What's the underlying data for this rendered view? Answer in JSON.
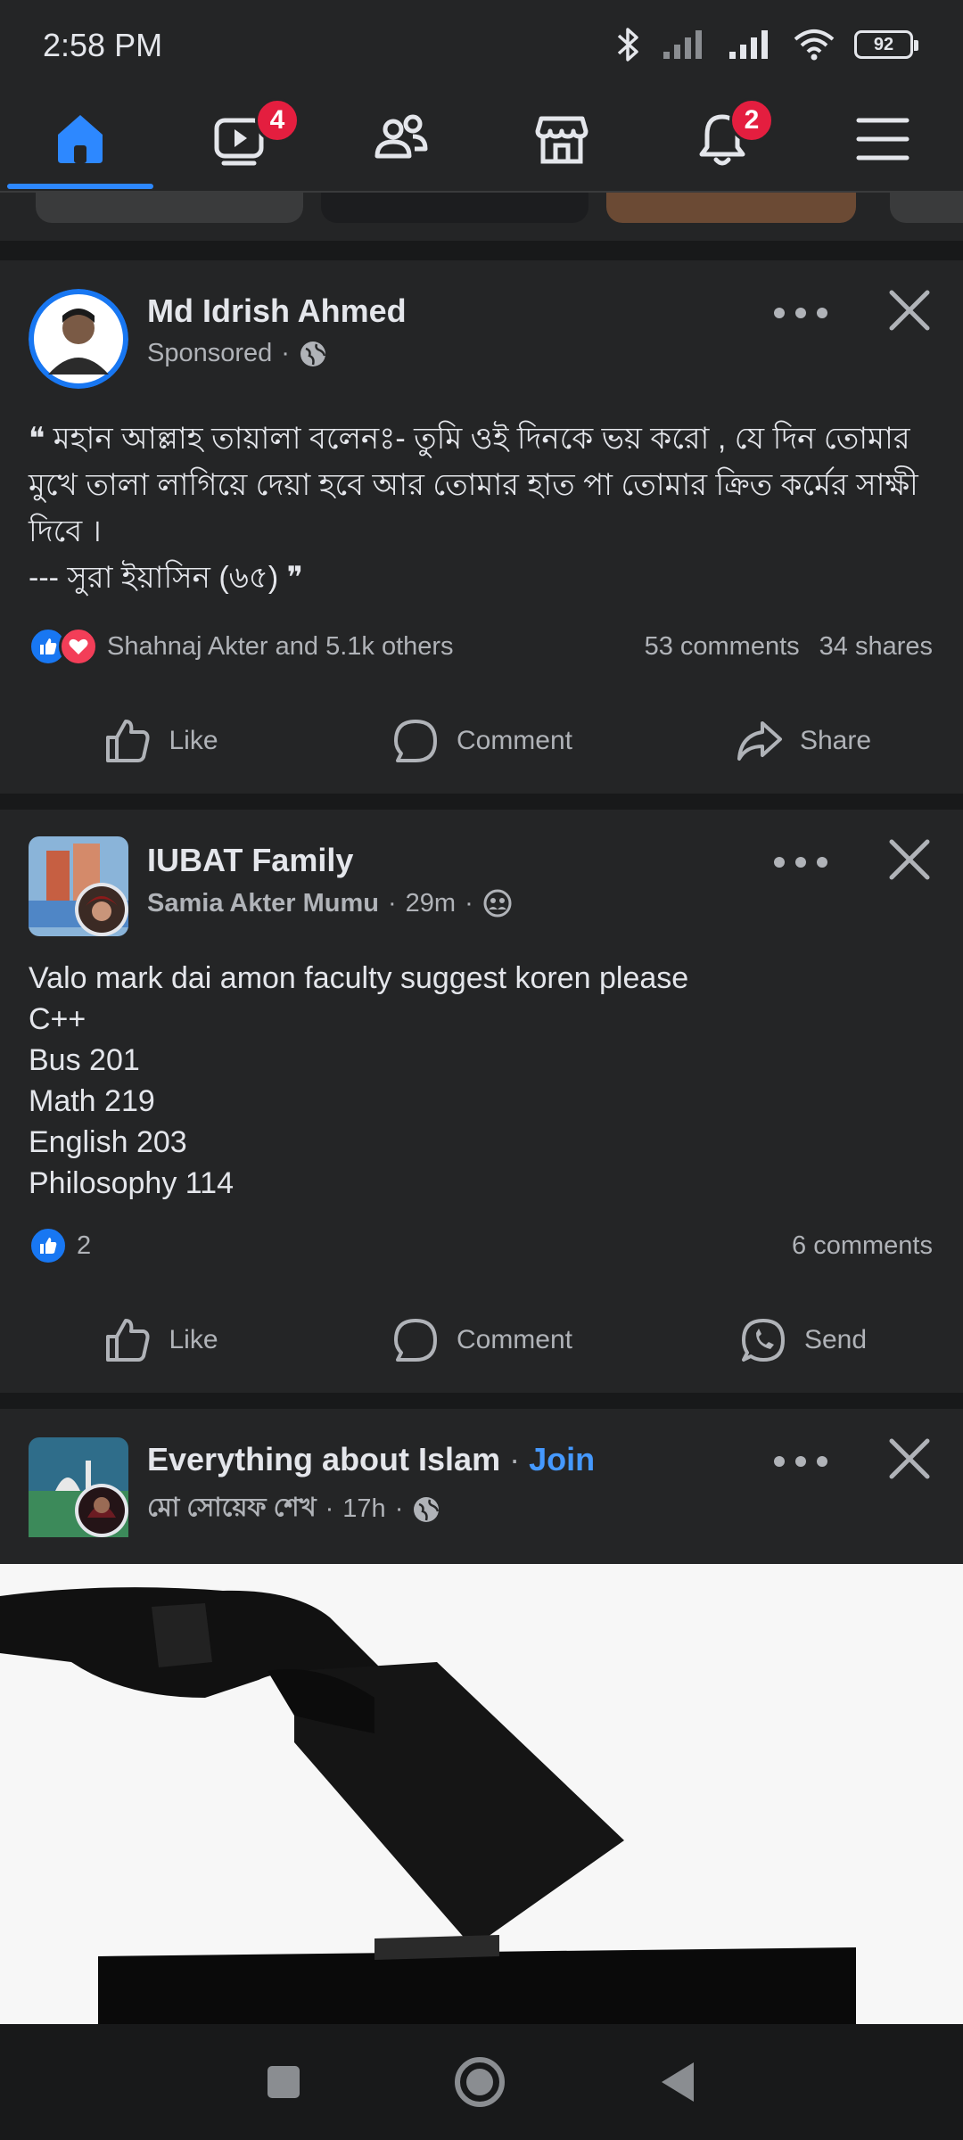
{
  "status_bar": {
    "time": "2:58 PM",
    "battery": "92"
  },
  "nav": {
    "watch_badge": "4",
    "notifications_badge": "2",
    "items": [
      "home-icon",
      "video-icon",
      "friends-icon",
      "marketplace-icon",
      "bell-icon",
      "menu-icon"
    ]
  },
  "posts": [
    {
      "author": "Md Idrish Ahmed",
      "meta": "Sponsored",
      "text": "❝ মহান আল্লাহ তায়ালা বলেনঃ- তুমি ওই দিনকে ভয় করো , যে দিন তোমার মুখে তালা লাগিয়ে দেয়া হবে আর তোমার হাত পা তোমার ক্রিত কর্মের সাক্ষী দিবে ।\n--- সুরা ইয়াসিন (৬৫)  ❞",
      "reactions": "Shahnaj Akter and 5.1k others",
      "comments": "53 comments",
      "shares": "34 shares",
      "actions": [
        "Like",
        "Comment",
        "Share"
      ]
    },
    {
      "group": "IUBAT Family",
      "author": "Samia Akter Mumu",
      "time": "29m",
      "text": "Valo mark dai amon faculty suggest koren please\nC++\nBus 201\nMath 219\nEnglish 203\nPhilosophy 114",
      "reactions": "2",
      "comments": "6 comments",
      "actions": [
        "Like",
        "Comment",
        "Send"
      ]
    },
    {
      "group": "Everything about Islam",
      "join": "Join",
      "author": "মো সোয়েফ শেখ",
      "time": "17h"
    }
  ],
  "colors": {
    "accent": "#2d88ff",
    "badge": "#e41e3f",
    "background": "#242526",
    "separator": "#18191a"
  }
}
